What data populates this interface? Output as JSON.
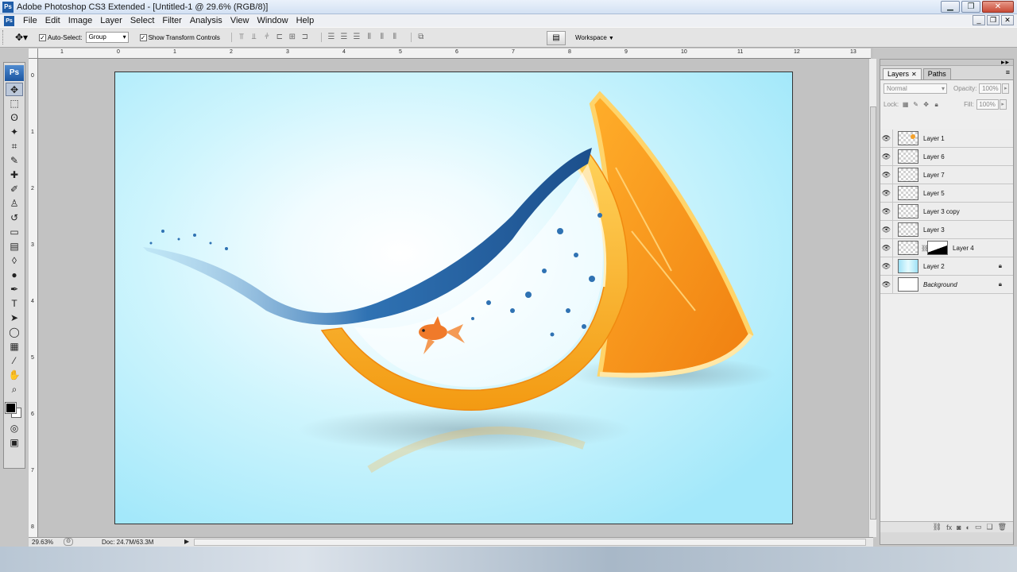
{
  "window": {
    "title": "Adobe Photoshop CS3 Extended - [Untitled-1 @ 29.6% (RGB/8)]",
    "app_icon": "Ps",
    "controls": [
      "minimize-icon",
      "restore-icon",
      "close-icon"
    ]
  },
  "menu": {
    "items": [
      "File",
      "Edit",
      "Image",
      "Layer",
      "Select",
      "Filter",
      "Analysis",
      "View",
      "Window",
      "Help"
    ]
  },
  "options_bar": {
    "auto_select_label": "Auto-Select:",
    "auto_select_checked": true,
    "auto_select_mode": "Group",
    "show_transform_label": "Show Transform Controls",
    "show_transform_checked": true,
    "workspace_label": "Workspace"
  },
  "toolbox": {
    "logo": "Ps",
    "tools": [
      {
        "name": "move-tool-icon",
        "glyph": "✥",
        "active": true
      },
      {
        "name": "marquee-tool-icon",
        "glyph": "⬚"
      },
      {
        "name": "lasso-tool-icon",
        "glyph": "ʘ"
      },
      {
        "name": "magic-wand-tool-icon",
        "glyph": "✦"
      },
      {
        "name": "crop-tool-icon",
        "glyph": "⌗"
      },
      {
        "name": "eyedropper-tool-icon",
        "glyph": "✎"
      },
      {
        "name": "healing-brush-tool-icon",
        "glyph": "✚"
      },
      {
        "name": "brush-tool-icon",
        "glyph": "✐"
      },
      {
        "name": "clone-stamp-tool-icon",
        "glyph": "♙"
      },
      {
        "name": "history-brush-tool-icon",
        "glyph": "↺"
      },
      {
        "name": "eraser-tool-icon",
        "glyph": "▭"
      },
      {
        "name": "gradient-tool-icon",
        "glyph": "▤"
      },
      {
        "name": "blur-tool-icon",
        "glyph": "◊"
      },
      {
        "name": "dodge-tool-icon",
        "glyph": "●"
      },
      {
        "name": "pen-tool-icon",
        "glyph": "✒"
      },
      {
        "name": "type-tool-icon",
        "glyph": "T"
      },
      {
        "name": "path-selection-tool-icon",
        "glyph": "➤"
      },
      {
        "name": "shape-tool-icon",
        "glyph": "◯"
      },
      {
        "name": "notes-tool-icon",
        "glyph": "▦"
      },
      {
        "name": "eyedropper2-tool-icon",
        "glyph": "⁄"
      },
      {
        "name": "hand-tool-icon",
        "glyph": "✋"
      },
      {
        "name": "zoom-tool-icon",
        "glyph": "⌕"
      }
    ],
    "quick_mask": "◎",
    "screen_mode": "▣"
  },
  "rulers": {
    "top_numbers": [
      "1",
      "0",
      "1",
      "2",
      "3",
      "4",
      "5",
      "6",
      "7",
      "8",
      "9",
      "10",
      "11",
      "12",
      "13"
    ],
    "left_numbers": [
      "0",
      "1",
      "2",
      "3",
      "4",
      "5",
      "6",
      "7",
      "8"
    ]
  },
  "status": {
    "zoom": "29.63%",
    "doc_info": "Doc: 24.7M/63.3M"
  },
  "layers_panel": {
    "tabs": [
      {
        "label": "Layers",
        "active": true,
        "closable": true
      },
      {
        "label": "Paths",
        "active": false,
        "closable": false
      }
    ],
    "blend_mode": "Normal",
    "opacity_label": "Opacity:",
    "opacity_value": "100%",
    "lock_label": "Lock:",
    "fill_label": "Fill:",
    "fill_value": "100%",
    "layers": [
      {
        "name": "Layer 1",
        "visible": true,
        "thumb": "checker-orange",
        "locked": false,
        "mask": false,
        "italic": false
      },
      {
        "name": "Layer 6",
        "visible": true,
        "thumb": "checker",
        "locked": false,
        "mask": false,
        "italic": false
      },
      {
        "name": "Layer 7",
        "visible": true,
        "thumb": "checker",
        "locked": false,
        "mask": false,
        "italic": false
      },
      {
        "name": "Layer 5",
        "visible": true,
        "thumb": "checker",
        "locked": false,
        "mask": false,
        "italic": false
      },
      {
        "name": "Layer 3 copy",
        "visible": true,
        "thumb": "checker",
        "locked": false,
        "mask": false,
        "italic": false
      },
      {
        "name": "Layer 3",
        "visible": true,
        "thumb": "checker",
        "locked": false,
        "mask": false,
        "italic": false
      },
      {
        "name": "Layer 4",
        "visible": true,
        "thumb": "checker",
        "locked": false,
        "mask": true,
        "italic": false
      },
      {
        "name": "Layer 2",
        "visible": true,
        "thumb": "blue",
        "locked": true,
        "mask": false,
        "italic": false
      },
      {
        "name": "Background",
        "visible": true,
        "thumb": "white",
        "locked": true,
        "mask": false,
        "italic": true
      }
    ],
    "footer_icons": [
      "link-layers-icon",
      "fx-icon",
      "add-mask-icon",
      "adjustment-layer-icon",
      "new-group-icon",
      "new-layer-icon",
      "delete-layer-icon"
    ]
  },
  "colors": {
    "canvas_bg_edge": "#a3e8fa",
    "canvas_bg_center": "#ffffff",
    "orange": "#f7a01c",
    "water": "#2a6fb0"
  }
}
